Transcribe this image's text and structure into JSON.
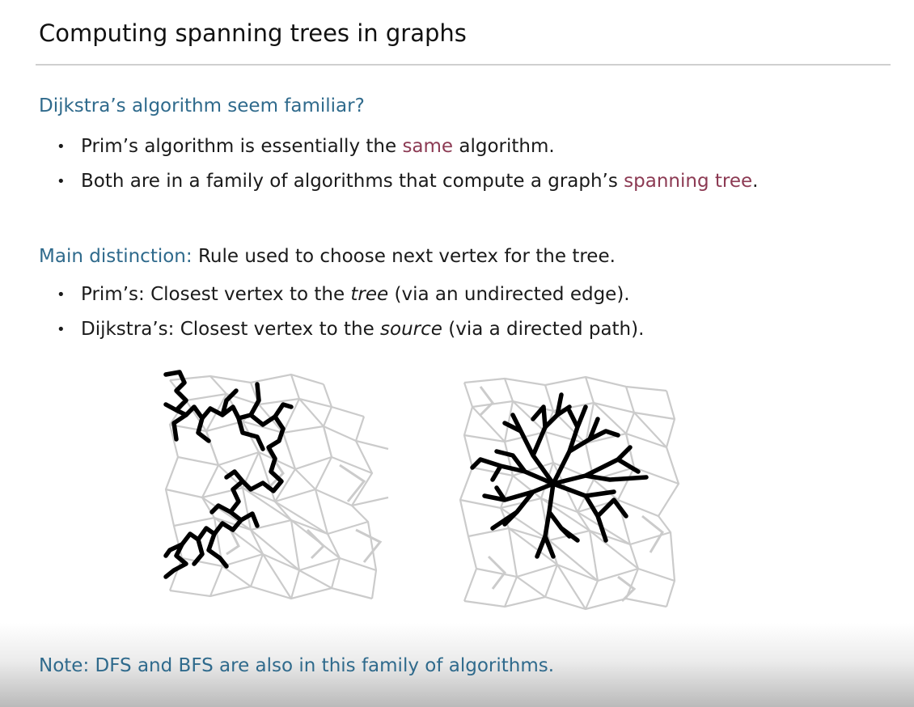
{
  "slide": {
    "title": "Computing spanning trees in graphs"
  },
  "section1": {
    "heading": "Dijkstra’s algorithm seem familiar?",
    "bullet1": {
      "before": "Prim’s algorithm is essentially the ",
      "highlight": "same",
      "after": " algorithm."
    },
    "bullet2": {
      "before": "Both are in a family of algorithms that compute a graph’s ",
      "highlight": "spanning tree",
      "after": "."
    }
  },
  "section2": {
    "heading": "Main distinction:",
    "text": " Rule used to choose next vertex for the tree.",
    "bullet1": {
      "before": "Prim’s: Closest vertex to the ",
      "italic": "tree",
      "after": " (via an undirected edge)."
    },
    "bullet2": {
      "before": "Dijkstra’s: Closest vertex to the ",
      "italic": "source",
      "after": " (via a directed path)."
    }
  },
  "note": "Note: DFS and BFS are also in this family of algorithms.",
  "colors": {
    "heading": "#2f6a8c",
    "highlight": "#8c3a53",
    "graph_edges": "#c8c8c8",
    "tree_edges": "#000000"
  }
}
